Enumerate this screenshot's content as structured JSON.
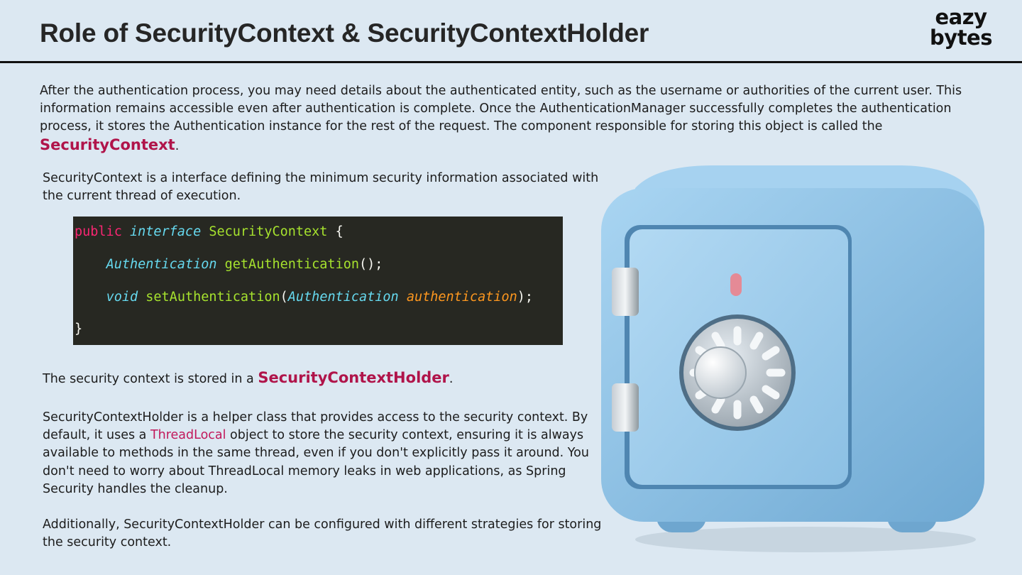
{
  "header": {
    "title": "Role of SecurityContext & SecurityContextHolder",
    "logo_line1": "eazy",
    "logo_line2": "bytes"
  },
  "intro": {
    "text": "After the authentication process, you may need details about the authenticated entity, such as the username or authorities of the current user. This information remains accessible even after authentication is complete. Once the AuthenticationManager successfully completes the authentication process, it stores the Authentication instance for the rest of the request. The component responsible for storing this object is called the ",
    "highlight": "SecurityContext",
    "end": "."
  },
  "security_context_desc": "SecurityContext is a interface defining the minimum security information associated with the current thread of execution.",
  "code": {
    "line1": {
      "kw": "public",
      "it": "interface",
      "cls": "SecurityContext",
      "brace": "{"
    },
    "line2": {
      "type": "Authentication",
      "method": "getAuthentication",
      "rest": "();"
    },
    "line3": {
      "kw": "void",
      "method": "setAuthentication",
      "open": "(",
      "type": "Authentication",
      "param": "authentication",
      "close": ");"
    },
    "line4": "}"
  },
  "holder_line": {
    "text": "The security context is stored in a ",
    "highlight": "SecurityContextHolder",
    "end": "."
  },
  "holder_desc": {
    "part1": "SecurityContextHolder is a helper class that provides access to the security context. By default, it uses a ",
    "highlight": "ThreadLocal",
    "part2": " object to store the security context, ensuring it is always available to methods in the same thread, even if you don't explicitly pass it around. You don't need to worry about ThreadLocal memory leaks in web applications, as Spring Security handles the cleanup."
  },
  "strategies": "Additionally, SecurityContextHolder can be configured with different strategies for storing the security context.",
  "colors": {
    "background": "#dce8f2",
    "accent": "#b0144a",
    "code_bg": "#272822",
    "safe_body": "#8cc3e6",
    "safe_door": "#a3cfee"
  },
  "icons": {
    "illustration": "safe-icon"
  }
}
